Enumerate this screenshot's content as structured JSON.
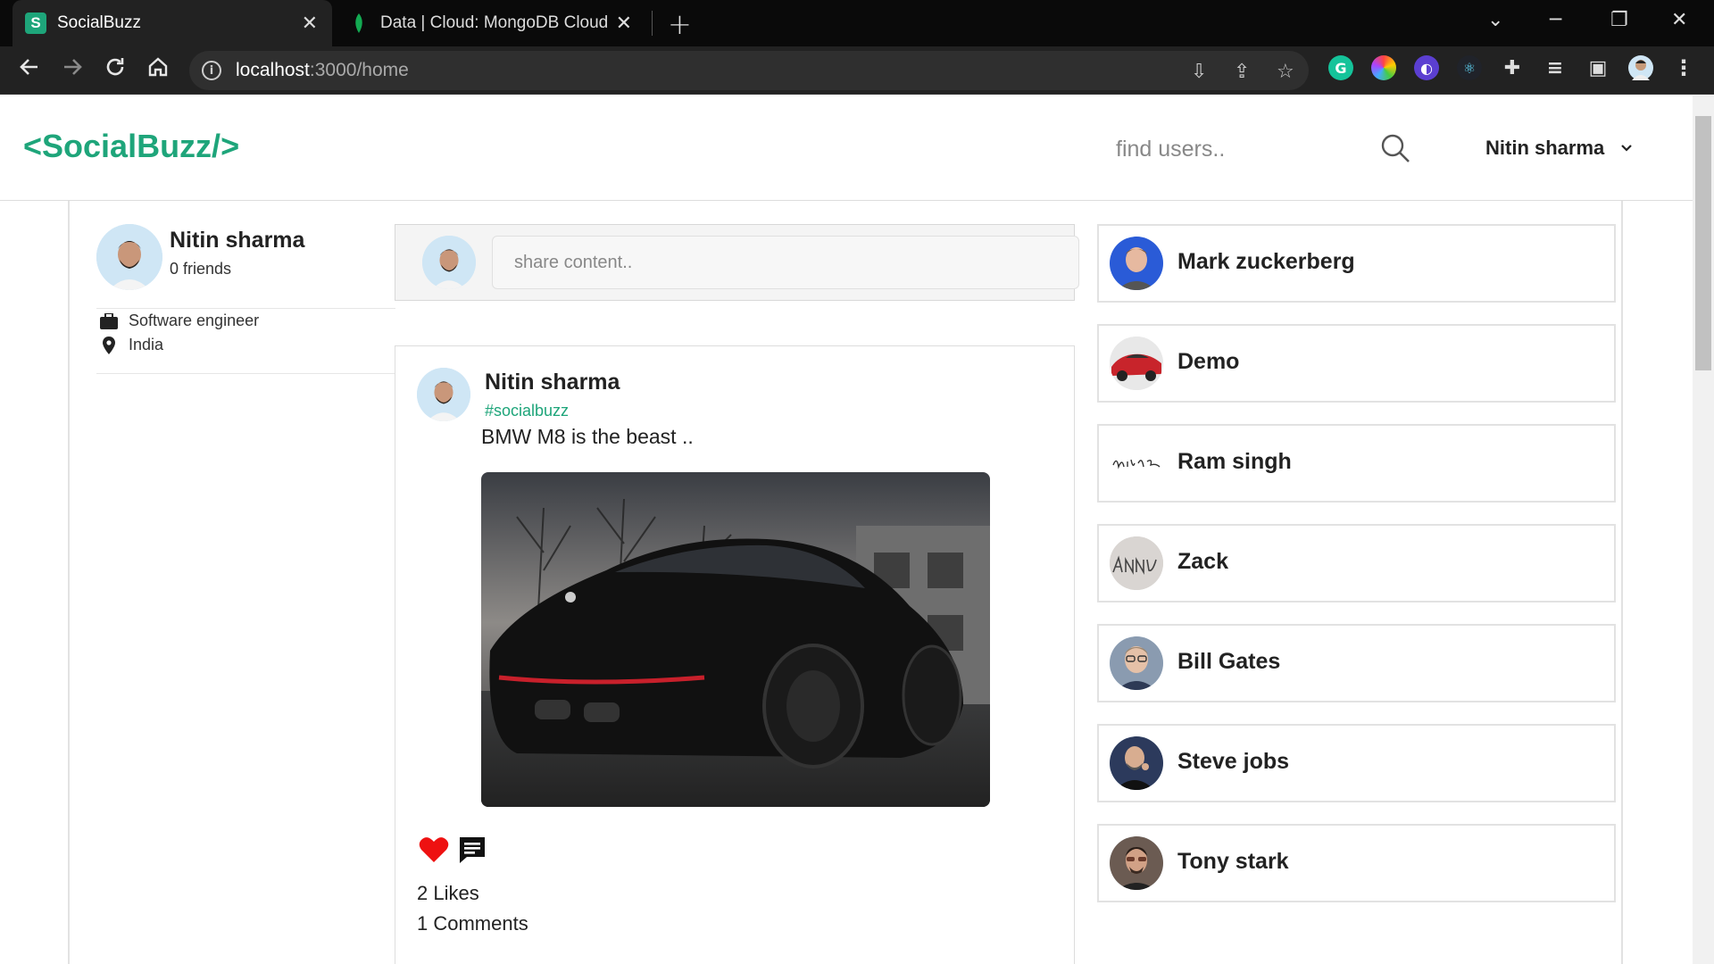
{
  "browser": {
    "tabs": [
      {
        "title": "SocialBuzz",
        "favicon": "S",
        "active": true
      },
      {
        "title": "Data | Cloud: MongoDB Cloud",
        "favicon": "leaf",
        "active": false
      }
    ],
    "url_host": "localhost",
    "url_path": ":3000/home"
  },
  "header": {
    "logo": "<SocialBuzz/>",
    "search_placeholder": "find users..",
    "user_name": "Nitin sharma"
  },
  "profile": {
    "name": "Nitin sharma",
    "friends": "0 friends",
    "occupation": "Software engineer",
    "location": "India"
  },
  "share": {
    "placeholder": "share content.."
  },
  "post": {
    "author": "Nitin sharma",
    "tag": "#socialbuzz",
    "text": "BMW M8 is the beast ..",
    "likes": "2 Likes",
    "comments": "1 Comments"
  },
  "friends": [
    {
      "name": "Mark zuckerberg",
      "avatar_color": "#2a5bd7"
    },
    {
      "name": "Demo",
      "avatar_color": "#c8242b"
    },
    {
      "name": "Ram singh",
      "avatar_color": "#ffffff"
    },
    {
      "name": "Zack",
      "avatar_color": "#d9d5d2"
    },
    {
      "name": "Bill Gates",
      "avatar_color": "#8a9bb0"
    },
    {
      "name": "Steve jobs",
      "avatar_color": "#2c3a5c"
    },
    {
      "name": "Tony stark",
      "avatar_color": "#6b5b52"
    }
  ],
  "colors": {
    "accent": "#1ea57a",
    "like": "#e11"
  }
}
